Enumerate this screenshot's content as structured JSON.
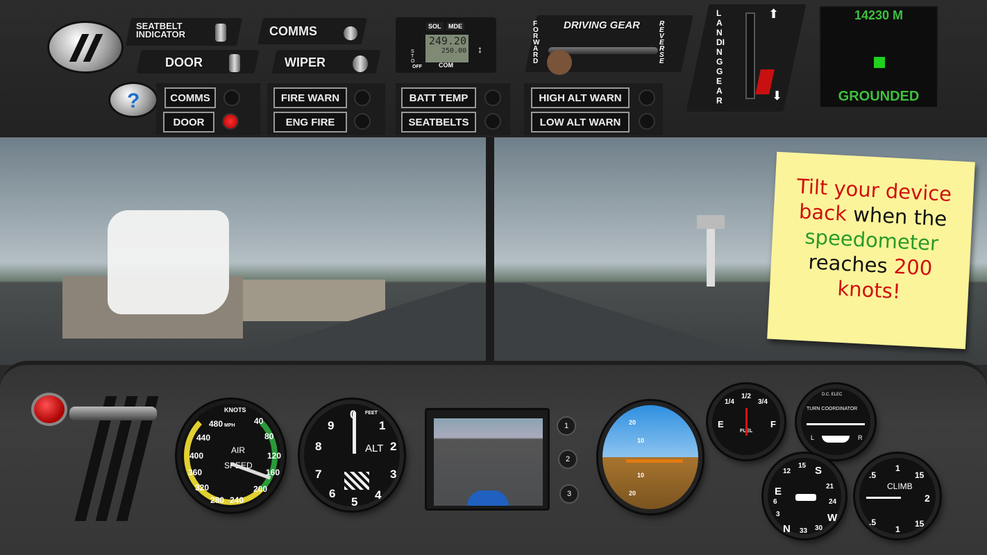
{
  "top_panel": {
    "seatbelt_indicator": "SEATBELT INDICATOR",
    "comms_switch": "COMMS",
    "door_switch": "DOOR",
    "wiper_switch": "WIPER",
    "warnings": [
      {
        "label": "COMMS",
        "lit": false
      },
      {
        "label": "DOOR",
        "lit": true
      },
      {
        "label": "FIRE WARN",
        "lit": false
      },
      {
        "label": "ENG FIRE",
        "lit": false
      },
      {
        "label": "BATT TEMP",
        "lit": false
      },
      {
        "label": "SEATBELTS",
        "lit": false
      },
      {
        "label": "HIGH ALT WARN",
        "lit": false
      },
      {
        "label": "LOW ALT WARN",
        "lit": false
      }
    ],
    "radio": {
      "btn1": "SOL",
      "btn2": "MDE",
      "side": "STO",
      "active": "249.20",
      "standby": "250.00",
      "off": "OFF",
      "com": "COM"
    },
    "driving_gear": {
      "title": "DRIVING GEAR",
      "left": "FORWARD",
      "right": "REVERSE"
    },
    "landing_gear": {
      "label": "LANDING GEAR"
    },
    "status": {
      "altitude": "14230 M",
      "state": "GROUNDED"
    }
  },
  "tutorial_note": {
    "line1a": "Tilt your device",
    "line2a": "back",
    "line2b": "when the",
    "line3": "speedometer",
    "line4a": "reaches",
    "line4b": "200",
    "line5": "knots!"
  },
  "instruments": {
    "airspeed": {
      "unit": "KNOTS",
      "sub": "MPH",
      "label1": "AIR",
      "label2": "SPEED",
      "ticks": [
        "40",
        "80",
        "120",
        "160",
        "200",
        "240",
        "280",
        "320",
        "360",
        "400",
        "440",
        "480"
      ]
    },
    "altimeter": {
      "label": "ALT",
      "unit": "FEET",
      "digits": [
        "0",
        "1",
        "2",
        "3",
        "4",
        "5",
        "6",
        "7",
        "8",
        "9"
      ]
    },
    "camera_buttons": [
      "1",
      "2",
      "3"
    ],
    "attitude": {
      "marks": [
        "20",
        "10",
        "10",
        "20"
      ]
    },
    "fuel": {
      "label": "FUEL",
      "marks": [
        "E",
        "1/4",
        "1/2",
        "3/4",
        "F"
      ]
    },
    "turn_coordinator": {
      "top": "D.C. ELEC",
      "title": "TURN COORDINATOR",
      "left": "L",
      "right": "R"
    },
    "heading": {
      "marks": [
        "E",
        "12",
        "15",
        "S",
        "21",
        "24",
        "W",
        "30",
        "33",
        "N",
        "3",
        "6"
      ]
    },
    "vsi": {
      "label": "CLIMB",
      "marks": [
        "1",
        ".5",
        "15",
        "2",
        "15",
        ".5",
        "1"
      ]
    }
  },
  "colors": {
    "panel": "#2a2a2a",
    "status_green": "#3fbf3f",
    "note_yellow": "#fbf49a",
    "warn_red": "#e01010"
  }
}
